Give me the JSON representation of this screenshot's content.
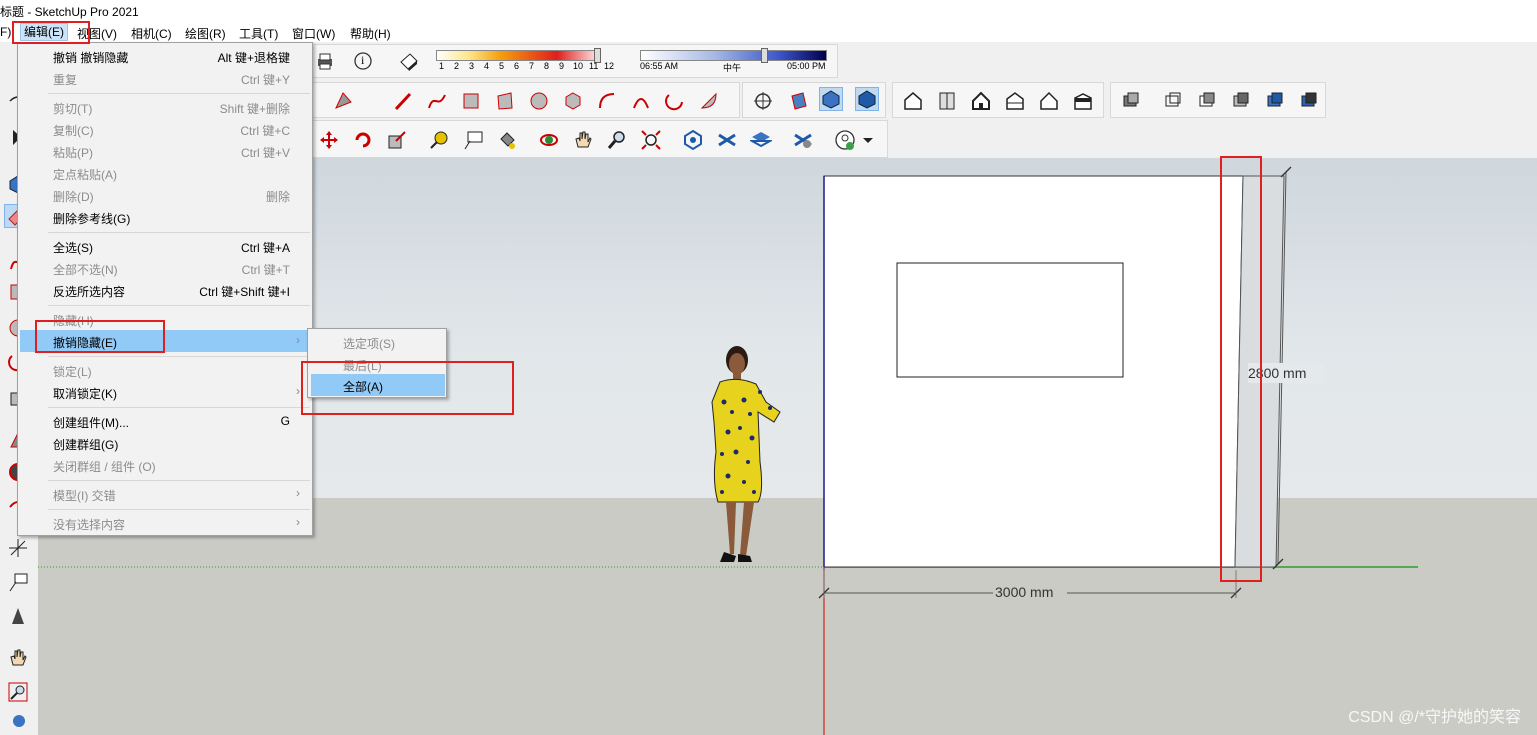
{
  "window": {
    "title": "标题 - SketchUp Pro 2021"
  },
  "menubar": {
    "items": [
      {
        "label": "F)"
      },
      {
        "label": "编辑(E)",
        "active": true
      },
      {
        "label": "视图(V)"
      },
      {
        "label": "相机(C)"
      },
      {
        "label": "绘图(R)"
      },
      {
        "label": "工具(T)"
      },
      {
        "label": "窗口(W)"
      },
      {
        "label": "帮助(H)"
      }
    ]
  },
  "shadow_settings": {
    "months": [
      "1",
      "2",
      "3",
      "4",
      "5",
      "6",
      "7",
      "8",
      "9",
      "10",
      "11",
      "12"
    ],
    "time_start": "06:55 AM",
    "time_mid": "中午",
    "time_end": "05:00 PM",
    "info_icon": "i"
  },
  "edit_menu": {
    "items": [
      {
        "label": "撤销 撤销隐藏",
        "shortcut": "Alt 键+退格键",
        "disabled": false
      },
      {
        "label": "重复",
        "shortcut": "Ctrl 键+Y",
        "disabled": true
      },
      {
        "label": "剪切(T)",
        "shortcut": "Shift 键+删除",
        "disabled": true
      },
      {
        "label": "复制(C)",
        "shortcut": "Ctrl 键+C",
        "disabled": true
      },
      {
        "label": "粘贴(P)",
        "shortcut": "Ctrl 键+V",
        "disabled": true
      },
      {
        "label": "定点粘贴(A)",
        "shortcut": "",
        "disabled": true
      },
      {
        "label": "删除(D)",
        "shortcut": "删除",
        "disabled": true
      },
      {
        "label": "删除参考线(G)",
        "shortcut": "",
        "disabled": false
      },
      {
        "label": "全选(S)",
        "shortcut": "Ctrl 键+A",
        "disabled": false
      },
      {
        "label": "全部不选(N)",
        "shortcut": "Ctrl 键+T",
        "disabled": true
      },
      {
        "label": "反选所选内容",
        "shortcut": "Ctrl 键+Shift 键+I",
        "disabled": false
      },
      {
        "label": "隐藏(H)",
        "shortcut": "",
        "disabled": true
      },
      {
        "label": "撤销隐藏(E)",
        "shortcut": "",
        "disabled": false,
        "selected": true,
        "submenu": true
      },
      {
        "label": "锁定(L)",
        "shortcut": "",
        "disabled": true
      },
      {
        "label": "取消锁定(K)",
        "shortcut": "",
        "disabled": false,
        "submenu": true
      },
      {
        "label": "创建组件(M)...",
        "shortcut": "G",
        "disabled": false
      },
      {
        "label": "创建群组(G)",
        "shortcut": "",
        "disabled": false
      },
      {
        "label": "关闭群组 / 组件 (O)",
        "shortcut": "",
        "disabled": true
      },
      {
        "label": "模型(I) 交错",
        "shortcut": "",
        "disabled": true,
        "submenu": true
      },
      {
        "label": "没有选择内容",
        "shortcut": "",
        "disabled": true,
        "submenu": true
      }
    ]
  },
  "unhide_submenu": {
    "items": [
      {
        "label": "选定项(S)",
        "disabled": true
      },
      {
        "label": "最后(L)",
        "disabled": true
      },
      {
        "label": "全部(A)",
        "disabled": false,
        "selected": true
      }
    ]
  },
  "model": {
    "width_dimension": "3000 mm",
    "height_dimension": "2800 mm"
  },
  "watermark": "CSDN @/*守护她的笑容",
  "colors": {
    "highlight_box": "#e02020",
    "menu_selected": "#91c9f7",
    "axis_red": "#d00000",
    "axis_green": "#00a000",
    "axis_blue": "#0000c0"
  }
}
